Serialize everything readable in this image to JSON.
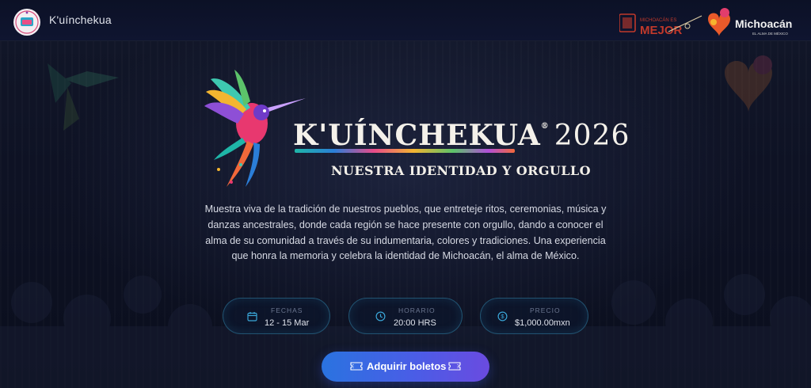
{
  "header": {
    "brand_name": "K'uínchekua",
    "partners": {
      "mejor_small": "MICHOACÁN ES",
      "mejor_big": "MEJOR",
      "michoacan_name": "Michoacán",
      "michoacan_tag": "EL ALMA DE MÉXICO"
    }
  },
  "hero": {
    "title": "K'UÍNCHEKUA",
    "registered": "®",
    "year": "2026",
    "subtitle": "NUESTRA IDENTIDAD Y ORGULLO",
    "description": "Muestra viva de la tradición de nuestros pueblos, que entreteje ritos, ceremonias, música y danzas ancestrales, donde cada región se hace presente con orgullo, dando a conocer el alma de su comunidad a través de su indumentaria, colores y tradiciones. Una experiencia que honra la memoria y celebra la identidad de Michoacán, el alma de México."
  },
  "info": {
    "fechas": {
      "label": "FECHAS",
      "value": "12 - 15 Mar",
      "icon": "calendar-icon"
    },
    "horario": {
      "label": "HORARIO",
      "value": "20:00 HRS",
      "icon": "clock-icon"
    },
    "precio": {
      "label": "PRECIO",
      "value": "$1,000.00mxn",
      "icon": "dollar-circle-icon"
    }
  },
  "cta": {
    "label": "Adquirir boletos",
    "icon": "ticket-icon"
  },
  "colors": {
    "background": "#0b1022",
    "accent_teal": "#1fb6a8",
    "cta_start": "#2a73e0",
    "cta_end": "#6a4be0",
    "pill_border": "#3ca0c8"
  }
}
